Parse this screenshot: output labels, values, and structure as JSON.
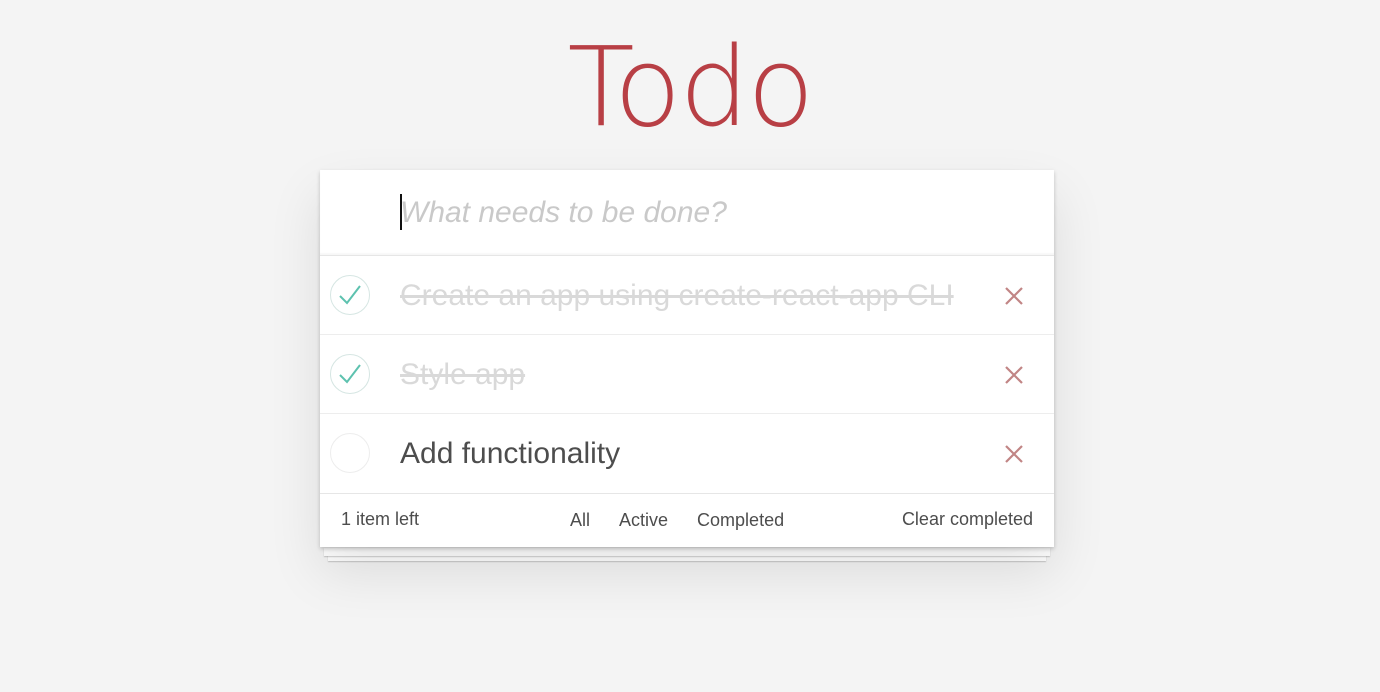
{
  "header": {
    "title": "Todo"
  },
  "new_todo": {
    "placeholder": "What needs to be done?",
    "value": ""
  },
  "todos": [
    {
      "label": "Create an app using create-react-app CLI",
      "completed": true
    },
    {
      "label": "Style app",
      "completed": true
    },
    {
      "label": "Add functionality",
      "completed": false
    }
  ],
  "footer": {
    "count_text": "1 item left",
    "filters": [
      "All",
      "Active",
      "Completed"
    ],
    "clear_label": "Clear completed"
  },
  "icons": {
    "toggle": "check-icon",
    "destroy": "close-icon"
  },
  "colors": {
    "title": "#b83f45",
    "check": "#5dc2af",
    "destroy": "#c18585",
    "background": "#f4f4f4"
  }
}
